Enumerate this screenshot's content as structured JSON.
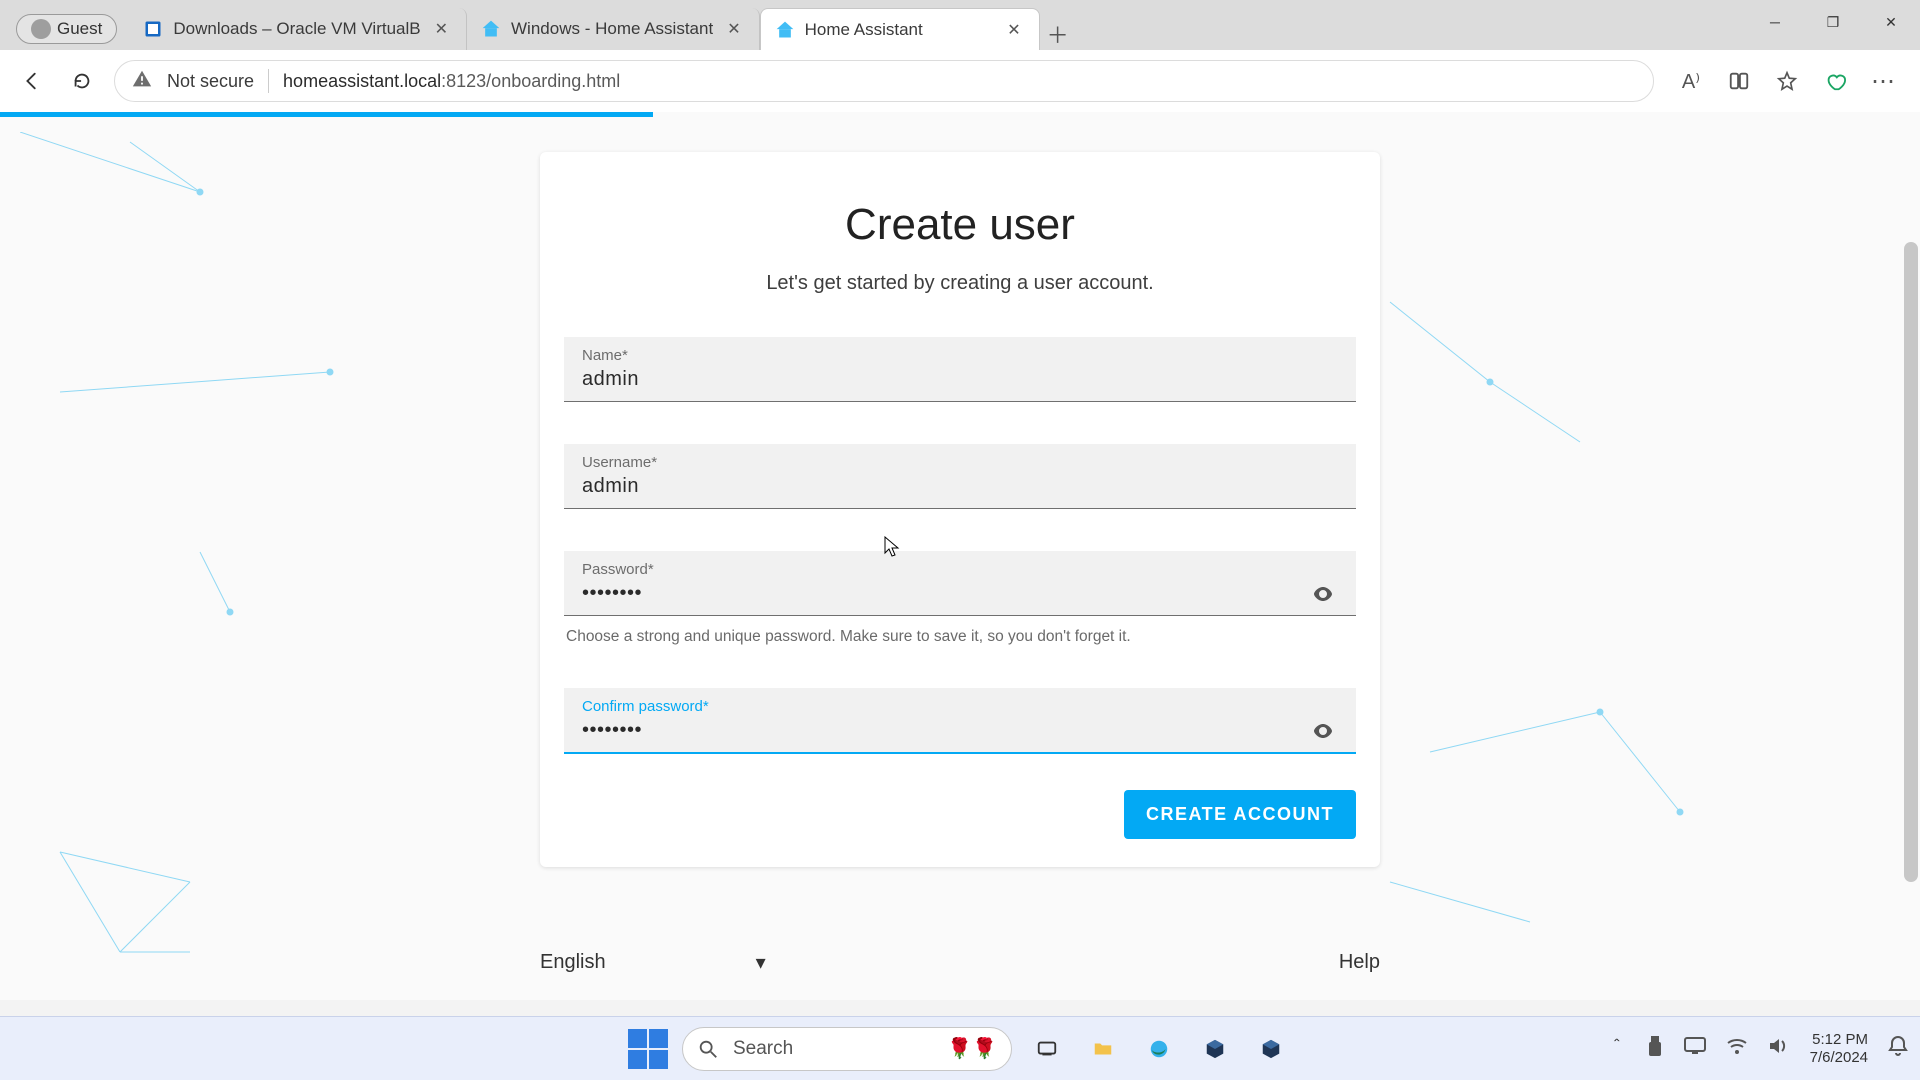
{
  "browser": {
    "guest_label": "Guest",
    "tabs": [
      {
        "title": "Downloads – Oracle VM VirtualB",
        "active": false
      },
      {
        "title": "Windows - Home Assistant",
        "active": false
      },
      {
        "title": "Home Assistant",
        "active": true
      }
    ],
    "url": {
      "security_label": "Not secure",
      "host": "homeassistant.local",
      "port_path": ":8123/onboarding.html"
    }
  },
  "page": {
    "progress_percent": 34,
    "title": "Create user",
    "subtitle": "Let's get started by creating a user account.",
    "fields": {
      "name": {
        "label": "Name*",
        "value": "admin"
      },
      "username": {
        "label": "Username*",
        "value": "admin"
      },
      "password": {
        "label": "Password*",
        "value": "••••••••",
        "helper": "Choose a strong and unique password. Make sure to save it, so you don't forget it."
      },
      "confirm": {
        "label": "Confirm password*",
        "value": "••••••••",
        "focused": true
      }
    },
    "create_button": "CREATE ACCOUNT",
    "language": "English",
    "help": "Help"
  },
  "taskbar": {
    "search_placeholder": "Search",
    "time": "5:12 PM",
    "date": "7/6/2024"
  },
  "icons": {
    "back": "back-icon",
    "reload": "reload-icon",
    "not_secure": "warning-icon",
    "read_aloud": "read-aloud-icon",
    "split": "split-screen-icon",
    "favorite": "favorite-icon",
    "extensions": "extensions-icon",
    "menu": "menu-icon",
    "eye": "eye-icon",
    "new_tab": "plus-icon",
    "minimize": "minimize-icon",
    "maximize": "restore-icon",
    "close": "close-icon",
    "task_view": "task-view-icon",
    "file_explorer": "file-explorer-icon",
    "edge": "edge-icon",
    "vbox": "virtualbox-icon",
    "usb": "usb-icon",
    "monitor": "monitor-icon",
    "wifi": "wifi-icon",
    "volume": "volume-icon",
    "notifications": "notifications-icon"
  }
}
